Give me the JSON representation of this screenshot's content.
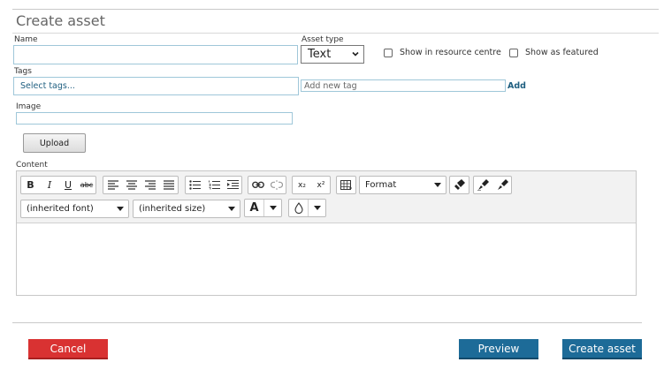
{
  "page": {
    "title": "Create asset"
  },
  "form": {
    "name_label": "Name",
    "name_value": "",
    "asset_type_label": "Asset type",
    "asset_type_value": "Text",
    "show_resource_label": "Show in resource centre",
    "show_resource_checked": false,
    "show_featured_label": "Show as featured",
    "show_featured_checked": false,
    "tags_label": "Tags",
    "tags_select_placeholder": "Select tags...",
    "new_tag_placeholder": "Add new tag",
    "add_tag_link": "Add",
    "image_label": "Image",
    "image_value": "",
    "upload_label": "Upload",
    "content_label": "Content"
  },
  "editor": {
    "bold": "B",
    "italic": "I",
    "underline": "U",
    "strike": "abc",
    "format_label": "Format",
    "font_label": "(inherited font)",
    "size_label": "(inherited size)",
    "font_color_glyph": "A",
    "subscript": "x₂",
    "superscript": "x²",
    "icons": {
      "align_left": "align-left-icon",
      "align_center": "align-center-icon",
      "align_right": "align-right-icon",
      "justify": "justify-icon",
      "bullets": "bullet-list-icon",
      "numbered": "numbered-list-icon",
      "indent": "indent-icon",
      "link": "link-icon",
      "unlink": "unlink-icon",
      "table": "table-icon",
      "clean": "eraser-icon",
      "brush": "format-painter-icon",
      "paint": "paint-brush-icon",
      "fill": "fill-drop-icon"
    },
    "content": ""
  },
  "actions": {
    "cancel": "Cancel",
    "preview": "Preview",
    "create": "Create asset"
  },
  "colors": {
    "cancel": "#d93232",
    "primary": "#1d6b98",
    "link": "#1f5f80",
    "input_border": "#9fc7d9"
  }
}
